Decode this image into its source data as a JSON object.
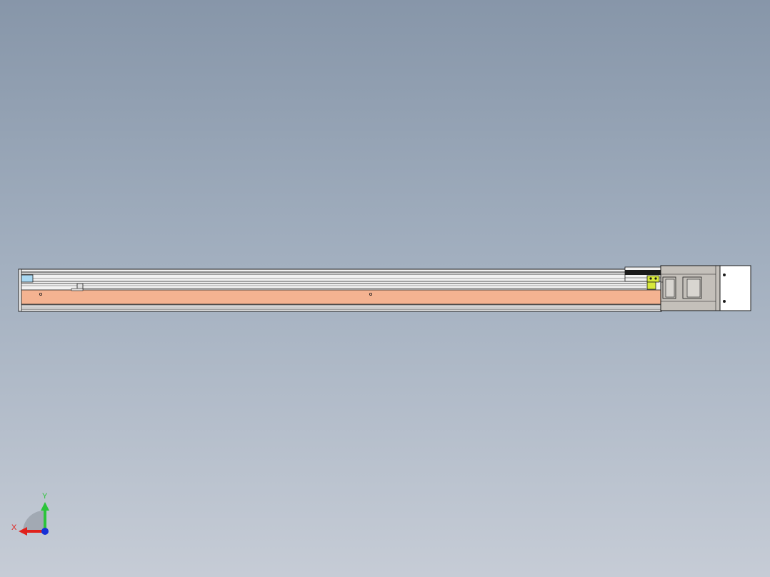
{
  "viewport": {
    "background_top": "#8796a9",
    "background_bottom": "#c6ccd6"
  },
  "model": {
    "name_icon": "linear-actuator-rail",
    "colors": {
      "outline": "#1a1a1a",
      "profile": "#f2f2f2",
      "orange_strip": "#f4b391",
      "carriage_gray": "#c4c0ba",
      "motor_cover": "#ffffff",
      "sensor_blue": "#a9d8f2",
      "sensor_yellow": "#d7e83a"
    }
  },
  "triad": {
    "x_label": "X",
    "y_label": "Y",
    "x_color": "#e0211c",
    "y_color": "#2bc43a",
    "z_color": "#1730d6"
  }
}
